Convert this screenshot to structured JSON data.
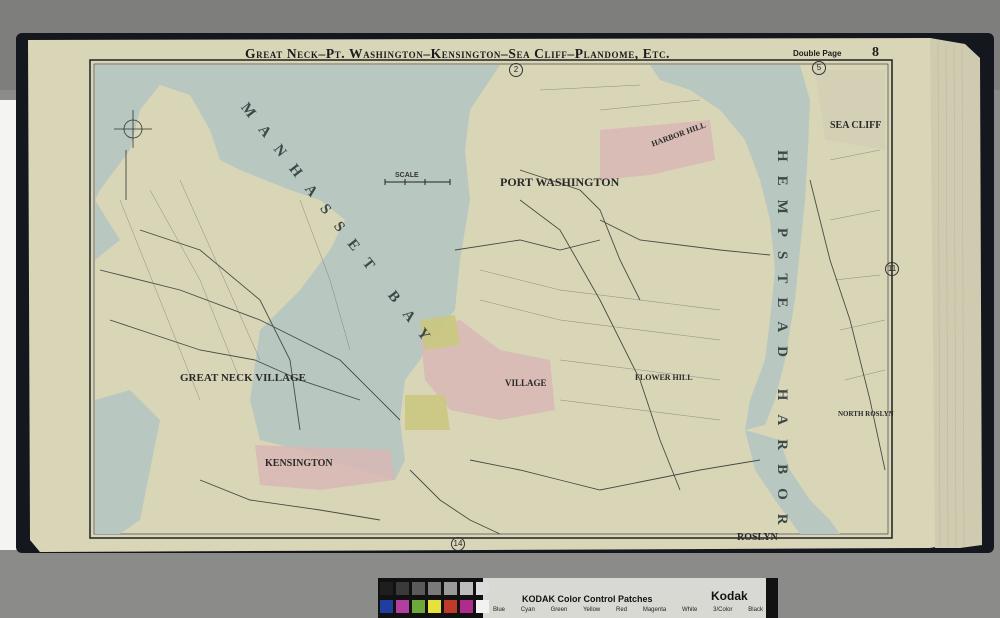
{
  "map": {
    "title": "Great Neck–Pt. Washington–Kensington–Sea Cliff–Plandome, Etc.",
    "page_type": "Double Page",
    "page_number": "8",
    "scale_label": "SCALE",
    "water_bodies": {
      "manhasset_bay": "MANHASSET BAY",
      "hempstead_harbor": "HEMPSTEAD HARBOR"
    },
    "places": {
      "great_neck_village": "GREAT NECK VILLAGE",
      "kensington": "KENSINGTON",
      "port_washington": "PORT WASHINGTON",
      "sea_cliff": "SEA CLIFF",
      "roslyn": "ROSLYN",
      "flower_hill": "FLOWER HILL",
      "north_roslyn": "NORTH ROSLYN",
      "plandome_village": "VILLAGE",
      "harbor_hill": "HARBOR HILL"
    },
    "adjacent_plates": [
      "2",
      "5",
      "11",
      "14"
    ]
  },
  "color_target": {
    "title": "KODAK Color Control Patches",
    "brand": "Kodak",
    "patches": [
      "Blue",
      "Cyan",
      "Green",
      "Yellow",
      "Red",
      "Magenta",
      "White",
      "3/Color",
      "Black"
    ],
    "gray_colors": [
      "#1e1e1e",
      "#3a3a3a",
      "#5a5a5a",
      "#7a7a7a",
      "#9a9a9a",
      "#bdbdbd",
      "#dcdcdc"
    ],
    "color_patches": [
      "#1f3fa0",
      "#b23fa0",
      "#6fa83a",
      "#e6e23a",
      "#c03a2a",
      "#b02c8c",
      "#f2f2f2",
      "#3a3a3a",
      "#111111"
    ]
  }
}
